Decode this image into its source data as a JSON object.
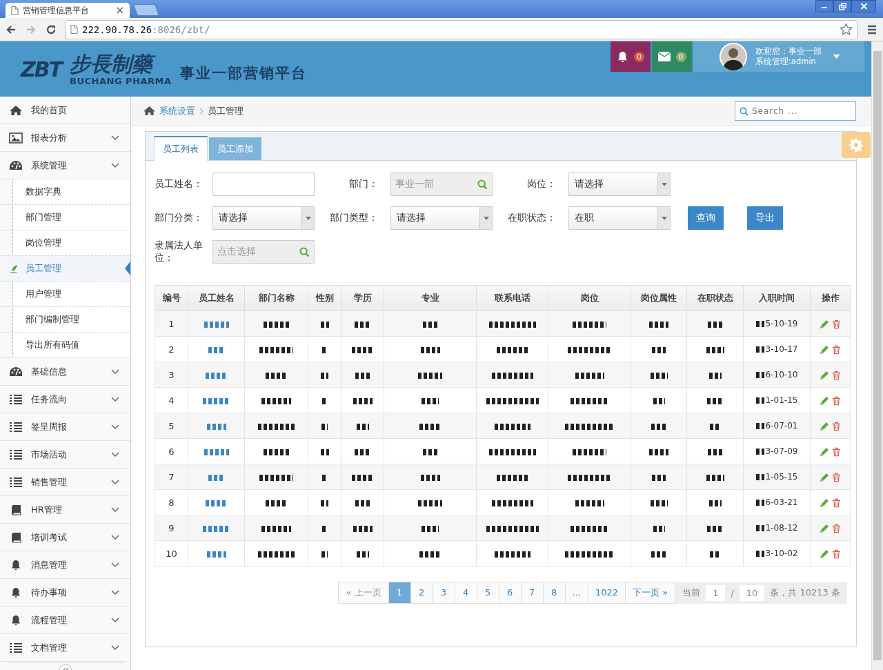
{
  "browser": {
    "tab": {
      "title": "营销管理信息平台",
      "close": "×"
    },
    "address": {
      "host": "222.90.78.26",
      "path": ":8026/zbt/"
    }
  },
  "header": {
    "logo_mark": "ZBT",
    "brand_cn": "步長制藥",
    "brand_en": "BUCHANG PHARMA",
    "platform": "事业一部营销平台",
    "notifications": [
      {
        "kind": "bell",
        "count": "0",
        "color": "#8b2a61"
      },
      {
        "kind": "mail",
        "count": "0",
        "color": "#2e8a63"
      }
    ],
    "user": {
      "greeting": "欢迎您：事业一部",
      "role": "系统管理:admin"
    }
  },
  "sidebar": {
    "items": [
      {
        "label": "我的首页",
        "kind": "home",
        "collapsible": false
      },
      {
        "label": "报表分析",
        "kind": "picture",
        "collapsible": true
      },
      {
        "label": "系统管理",
        "kind": "dashboard",
        "collapsible": true,
        "children": [
          {
            "label": "数据字典",
            "selected": false
          },
          {
            "label": "部门管理",
            "selected": false
          },
          {
            "label": "岗位管理",
            "selected": false
          },
          {
            "label": "员工管理",
            "selected": true
          },
          {
            "label": "用户管理",
            "selected": false
          },
          {
            "label": "部门编制管理",
            "selected": false
          },
          {
            "label": "导出所有码值",
            "selected": false
          }
        ]
      },
      {
        "label": "基础信息",
        "kind": "dashboard",
        "collapsible": true
      },
      {
        "label": "任务流向",
        "kind": "list",
        "collapsible": true
      },
      {
        "label": "签呈周报",
        "kind": "list",
        "collapsible": true
      },
      {
        "label": "市场活动",
        "kind": "list",
        "collapsible": true
      },
      {
        "label": "销售管理",
        "kind": "list",
        "collapsible": true
      },
      {
        "label": "HR管理",
        "kind": "book",
        "collapsible": true
      },
      {
        "label": "培训考试",
        "kind": "book",
        "collapsible": true
      },
      {
        "label": "消息管理",
        "kind": "bell",
        "collapsible": true
      },
      {
        "label": "待办事项",
        "kind": "bell",
        "collapsible": true
      },
      {
        "label": "流程管理",
        "kind": "bell",
        "collapsible": true
      },
      {
        "label": "文档管理",
        "kind": "list",
        "collapsible": true
      }
    ]
  },
  "breadcrumb": [
    {
      "label": "系统设置",
      "link": true
    },
    {
      "label": "员工管理",
      "link": false
    }
  ],
  "search": {
    "placeholder": "Search ..."
  },
  "tabs": [
    {
      "label": "员工列表",
      "selected": true
    },
    {
      "label": "员工添加",
      "selected": false
    }
  ],
  "filters": [
    {
      "label": "员工姓名：",
      "kind": "text"
    },
    {
      "label": "部门：",
      "kind": "lookup",
      "value": "事业一部"
    },
    {
      "label": "岗位：",
      "kind": "select",
      "value": "请选择"
    },
    {
      "label": "部门分类：",
      "kind": "select",
      "value": "请选择"
    },
    {
      "label": "部门类型：",
      "kind": "select",
      "value": "请选择"
    },
    {
      "label": "在职状态：",
      "kind": "select",
      "value": "在职"
    },
    {
      "label": "隶属法人单位：",
      "kind": "lookup",
      "placeholder": "点击选择"
    }
  ],
  "buttons": [
    "查询",
    "导出"
  ],
  "table": {
    "columns": [
      "编号",
      "员工姓名",
      "部门名称",
      "性别",
      "学历",
      "专业",
      "联系电话",
      "岗位",
      "岗位属性",
      "在职状态",
      "入职时间",
      "操作"
    ],
    "rows": [
      {
        "no": "1",
        "hire_date": "5-10-19"
      },
      {
        "no": "2",
        "hire_date": "3-10-17"
      },
      {
        "no": "3",
        "hire_date": "6-10-10"
      },
      {
        "no": "4",
        "hire_date": "1-01-15"
      },
      {
        "no": "5",
        "hire_date": "6-07-01"
      },
      {
        "no": "6",
        "hire_date": "3-07-09"
      },
      {
        "no": "7",
        "hire_date": "1-05-15"
      },
      {
        "no": "8",
        "hire_date": "6-03-21"
      },
      {
        "no": "9",
        "hire_date": "1-08-12"
      },
      {
        "no": "10",
        "hire_date": "3-10-02"
      }
    ]
  },
  "pagination": {
    "prev": "« 上一页",
    "pages": [
      {
        "label": "1",
        "selected": true
      },
      {
        "label": "2",
        "selected": false
      },
      {
        "label": "3",
        "selected": false
      },
      {
        "label": "4",
        "selected": false
      },
      {
        "label": "5",
        "selected": false
      },
      {
        "label": "6",
        "selected": false
      },
      {
        "label": "7",
        "selected": false
      },
      {
        "label": "8",
        "selected": false
      },
      {
        "label": "...",
        "selected": false
      },
      {
        "label": "1022",
        "selected": false
      }
    ],
    "next": "下一页 »",
    "current_label": "当前",
    "current_page": "1",
    "separator": "/",
    "page_size": "10",
    "total": "条，共 10213 条"
  }
}
